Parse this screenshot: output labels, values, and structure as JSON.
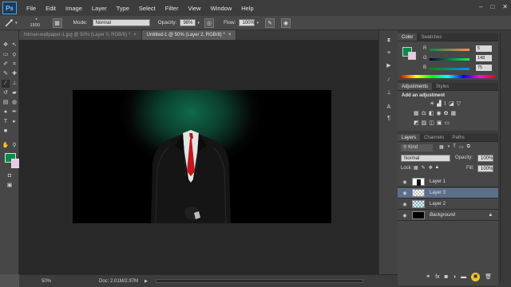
{
  "app": {
    "logo": "Ps"
  },
  "menu": [
    "File",
    "Edit",
    "Image",
    "Layer",
    "Type",
    "Select",
    "Filter",
    "View",
    "Window",
    "Help"
  ],
  "window_controls": [
    "–",
    "□",
    "✕"
  ],
  "options": {
    "brush_size": "1500",
    "mode_label": "Mode:",
    "mode_value": "Normal",
    "opacity_label": "Opacity:",
    "opacity_value": "98%",
    "flow_label": "Flow:",
    "flow_value": "100%"
  },
  "tabs": [
    {
      "label": "hitman-wallpaper-1.jpg @ 50% (Layer 0, RGB/8) *",
      "close": "×"
    },
    {
      "label": "Untitled-1 @ 50% (Layer 2, RGB/8) *",
      "close": "×"
    }
  ],
  "status": {
    "zoom": "50%",
    "doc": "Doc: 2.01M/2.97M"
  },
  "color_panel": {
    "tabs": [
      "Color",
      "Swatches"
    ],
    "r_label": "R",
    "r_value": "5",
    "g_label": "G",
    "g_value": "148",
    "b_label": "B",
    "b_value": "75",
    "foreground": "#058c4b"
  },
  "adjustments_panel": {
    "tabs": [
      "Adjustments",
      "Styles"
    ],
    "title": "Add an adjustment"
  },
  "layers_panel": {
    "tabs": [
      "Layers",
      "Channels",
      "Paths"
    ],
    "kind_label": "Kind",
    "blend_mode": "Normal",
    "opacity_label": "Opacity:",
    "opacity_value": "100%",
    "lock_label": "Lock:",
    "fill_label": "Fill:",
    "fill_value": "100%",
    "layers": [
      {
        "name": "Layer 1",
        "selected": false
      },
      {
        "name": "Layer 3",
        "selected": true
      },
      {
        "name": "Layer 2",
        "selected": false
      },
      {
        "name": "Background",
        "selected": false
      }
    ]
  },
  "colors": {
    "accent": "#058c4b",
    "selection": "#5b6f8a",
    "highlight": "#f4c430"
  }
}
